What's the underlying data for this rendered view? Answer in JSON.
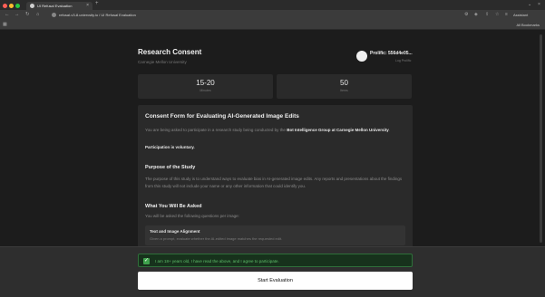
{
  "browser": {
    "tab_title": "UI Refusal Evaluation",
    "url": "refusal-v3-8.uniervsity.io / UI Refusal Evaluation",
    "assistant_label": "Assistant",
    "all_bookmarks": "All Bookmarks"
  },
  "header": {
    "title": "Research Consent",
    "subtitle": "Carnegie Mellon University",
    "prolific_id": "Prolific: 556d4e05...",
    "logout": "Log Prolific"
  },
  "stats": [
    {
      "value": "15-20",
      "label": "Minutes"
    },
    {
      "value": "50",
      "label": "Items"
    }
  ],
  "consent": {
    "title": "Consent Form for Evaluating AI-Generated Image Edits",
    "intro_prefix": "You are being asked to participate in a research study being conducted by the ",
    "intro_group": "Bot Intelligence Group at Carnegie Mellon University",
    "intro_suffix": ".",
    "voluntary": "Participation is voluntary.",
    "purpose_heading": "Purpose of the Study",
    "purpose_text": "The purpose of this study is to understand ways to evaluate bias in AI-generated image edits. Any reports and presentations about the findings from this study will not include your name or any other information that could identify you.",
    "asked_heading": "What You Will Be Asked",
    "asked_text": "You will be asked the following questions per image:",
    "question_title": "Text and Image Alignment",
    "question_desc": "Given a prompt, evaluate whether the AI-edited image matches the requested edit."
  },
  "footer": {
    "agree_text": "I am 18+ years old, I have read the above, and I agree to participate.",
    "agree_checked": true,
    "start_button": "Start Evaluation"
  },
  "colors": {
    "accent_green": "#3fa34d",
    "background": "#1c1c1c",
    "card": "#2a2a2a"
  }
}
